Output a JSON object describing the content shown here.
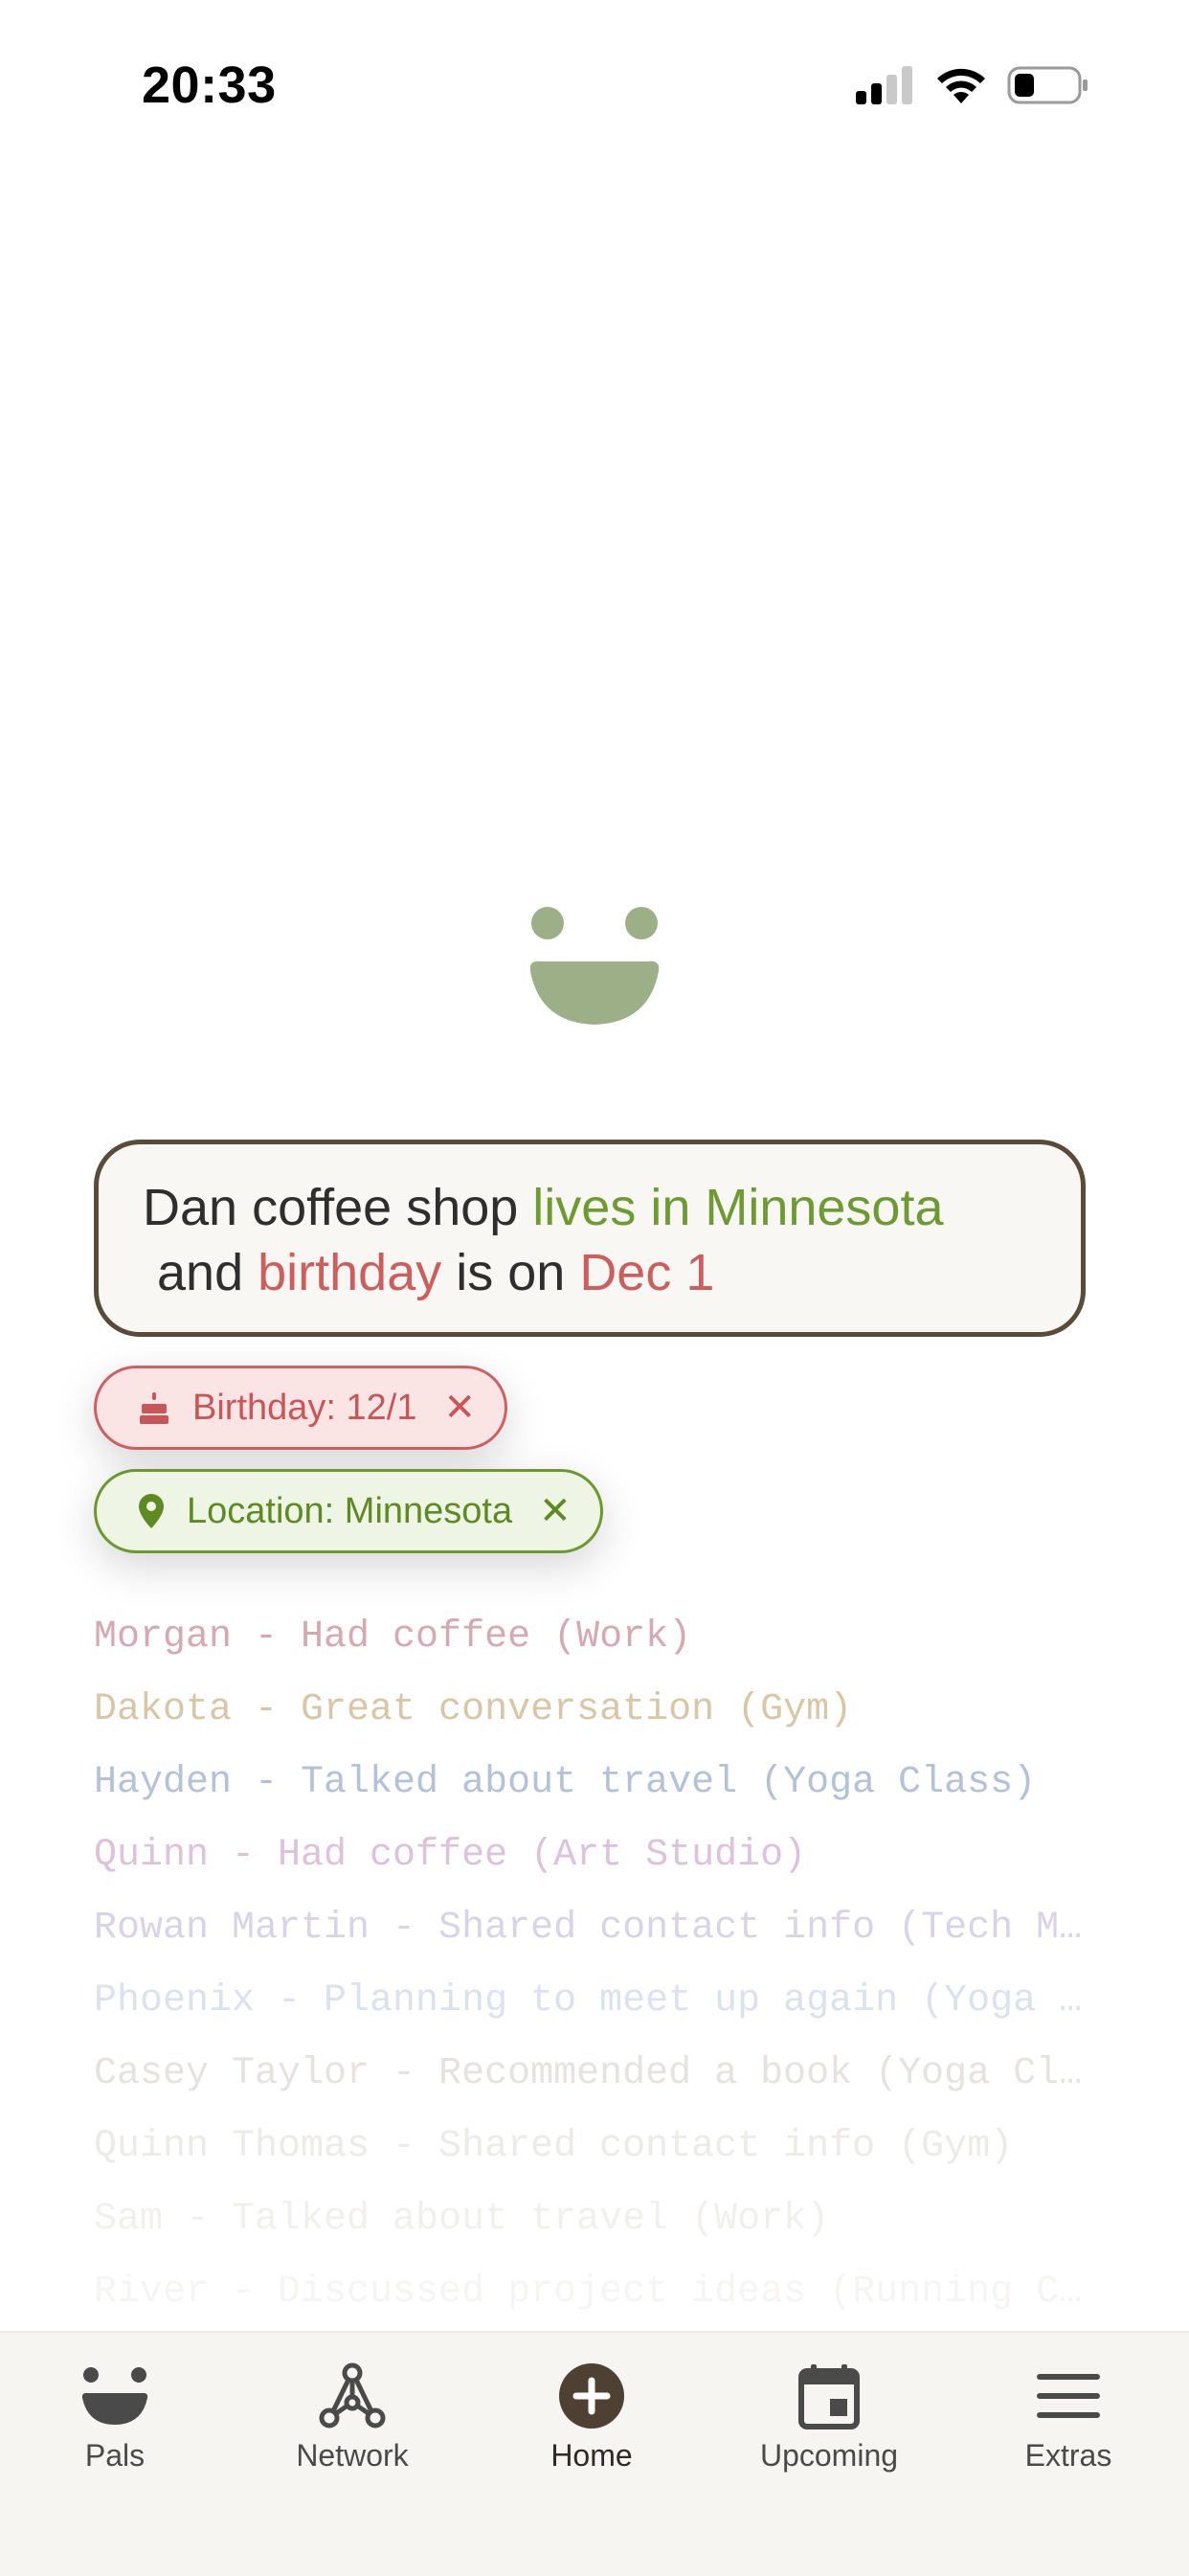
{
  "status_bar": {
    "time": "20:33"
  },
  "note": {
    "segments": [
      {
        "text": "Dan coffee shop ",
        "tone": "plain"
      },
      {
        "text": "lives in Minnesota",
        "tone": "green"
      },
      {
        "text": " and ",
        "tone": "plain"
      },
      {
        "text": "birthday",
        "tone": "red"
      },
      {
        "text": " is on ",
        "tone": "plain"
      },
      {
        "text": "Dec 1",
        "tone": "red"
      }
    ]
  },
  "chips": {
    "birthday": {
      "label": "Birthday: 12/1",
      "icon": "cake-icon"
    },
    "location": {
      "label": "Location: Minnesota",
      "icon": "pin-icon"
    }
  },
  "feed": {
    "items": [
      {
        "text": "Morgan - Had coffee (Work)",
        "color": "#d4a9b3"
      },
      {
        "text": "Dakota - Great conversation (Gym)",
        "color": "#d8c7a6"
      },
      {
        "text": "Hayden - Talked about travel (Yoga Class)",
        "color": "#b3c2d8"
      },
      {
        "text": "Quinn - Had coffee (Art Studio)",
        "color": "#dcc2da"
      },
      {
        "text": "Rowan Martin - Shared contact info (Tech Meetup)",
        "color": "#d8d3e6"
      },
      {
        "text": "Phoenix - Planning to meet up again (Yoga Class)",
        "color": "#dbe2ee"
      },
      {
        "text": "Casey Taylor - Recommended a book (Yoga Class)",
        "color": "#e6e2e0"
      },
      {
        "text": "Quinn Thomas - Shared contact info (Gym)",
        "color": "#ecebe8"
      },
      {
        "text": "Sam - Talked about travel (Work)",
        "color": "#f1f0ed"
      },
      {
        "text": "River - Discussed project ideas (Running Club)",
        "color": "#f6f5f3"
      }
    ]
  },
  "nav": {
    "items": [
      {
        "label": "Pals",
        "icon": "smile-icon"
      },
      {
        "label": "Network",
        "icon": "network-icon"
      },
      {
        "label": "Home",
        "icon": "plus-circle-icon"
      },
      {
        "label": "Upcoming",
        "icon": "calendar-icon"
      },
      {
        "label": "Extras",
        "icon": "menu-icon"
      }
    ]
  },
  "colors": {
    "logo": "#9caf86",
    "card_border": "#5a4a3a",
    "accent_green": "#6e9a32",
    "accent_red": "#cc5e5e"
  }
}
